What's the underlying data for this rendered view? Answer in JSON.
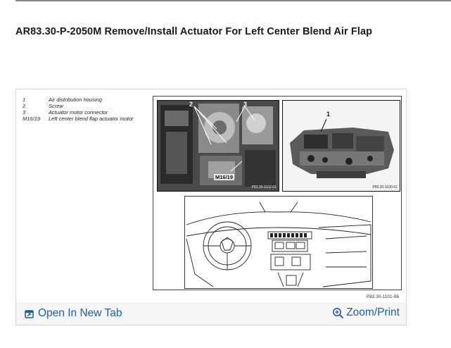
{
  "page": {
    "title": "AR83.30-P-2050M Remove/Install Actuator For Left Center Blend Air Flap"
  },
  "figure": {
    "legend": [
      {
        "num": "1",
        "text": "Air distribution housing"
      },
      {
        "num": "2",
        "text": "Screw"
      },
      {
        "num": "3",
        "text": "Actuator motor connector"
      },
      {
        "num": "M16/19",
        "text": "Left center blend flap actuator motor"
      }
    ],
    "callouts": {
      "one": "1",
      "two": "2",
      "three": "3",
      "m16": "M16/19"
    },
    "photo_codes": {
      "left": "P83.30-1102-01",
      "right": "P83.30-1100-01"
    },
    "reference": "P83.30-1101-06"
  },
  "footer": {
    "open_label": "Open In New Tab",
    "open_icon": "open-new-tab-icon",
    "zoom_label": "Zoom/Print",
    "zoom_icon": "zoom-in-icon",
    "link_color": "#1f5fa8"
  }
}
